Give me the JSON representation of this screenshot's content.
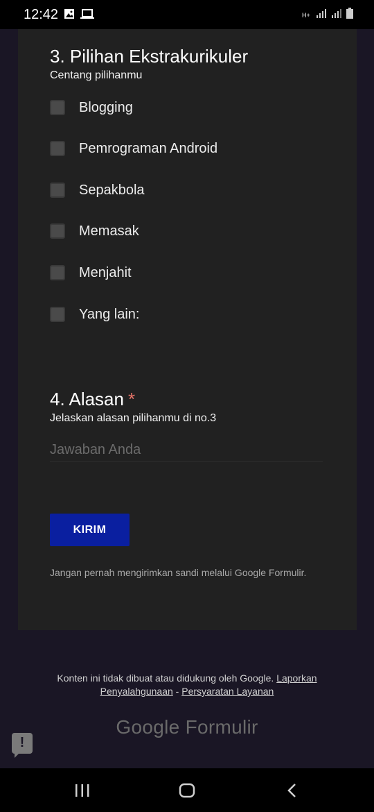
{
  "status_bar": {
    "time": "12:42",
    "network": "H+"
  },
  "question3": {
    "title": "3. Pilihan Ekstrakurikuler",
    "description": "Centang pilihanmu",
    "options": [
      "Blogging",
      "Pemrograman Android",
      "Sepakbola",
      "Memasak",
      "Menjahit",
      "Yang lain:"
    ]
  },
  "question4": {
    "title": "4. Alasan",
    "required_mark": "*",
    "description": "Jelaskan alasan pilihanmu di no.3",
    "answer_placeholder": "Jawaban Anda"
  },
  "submit_label": "KIRIM",
  "password_notice": "Jangan pernah mengirimkan sandi melalui Google Formulir.",
  "footer": {
    "text": "Konten ini tidak dibuat atau didukung oleh Google.",
    "report_link": "Laporkan Penyalahgunaan",
    "separator": "-",
    "terms_link": "Persyaratan Layanan"
  },
  "brand": {
    "google": "Google",
    "product": "Formulir"
  },
  "report_icon_glyph": "!",
  "colors": {
    "background": "#1a1625",
    "card": "#212121",
    "submit_button": "#0a1fa0",
    "required": "#e57368"
  },
  "icons": [
    "image-icon",
    "laptop-icon",
    "signal-icon",
    "battery-icon",
    "report-issue-icon",
    "recent-apps-icon",
    "home-icon",
    "back-icon"
  ]
}
